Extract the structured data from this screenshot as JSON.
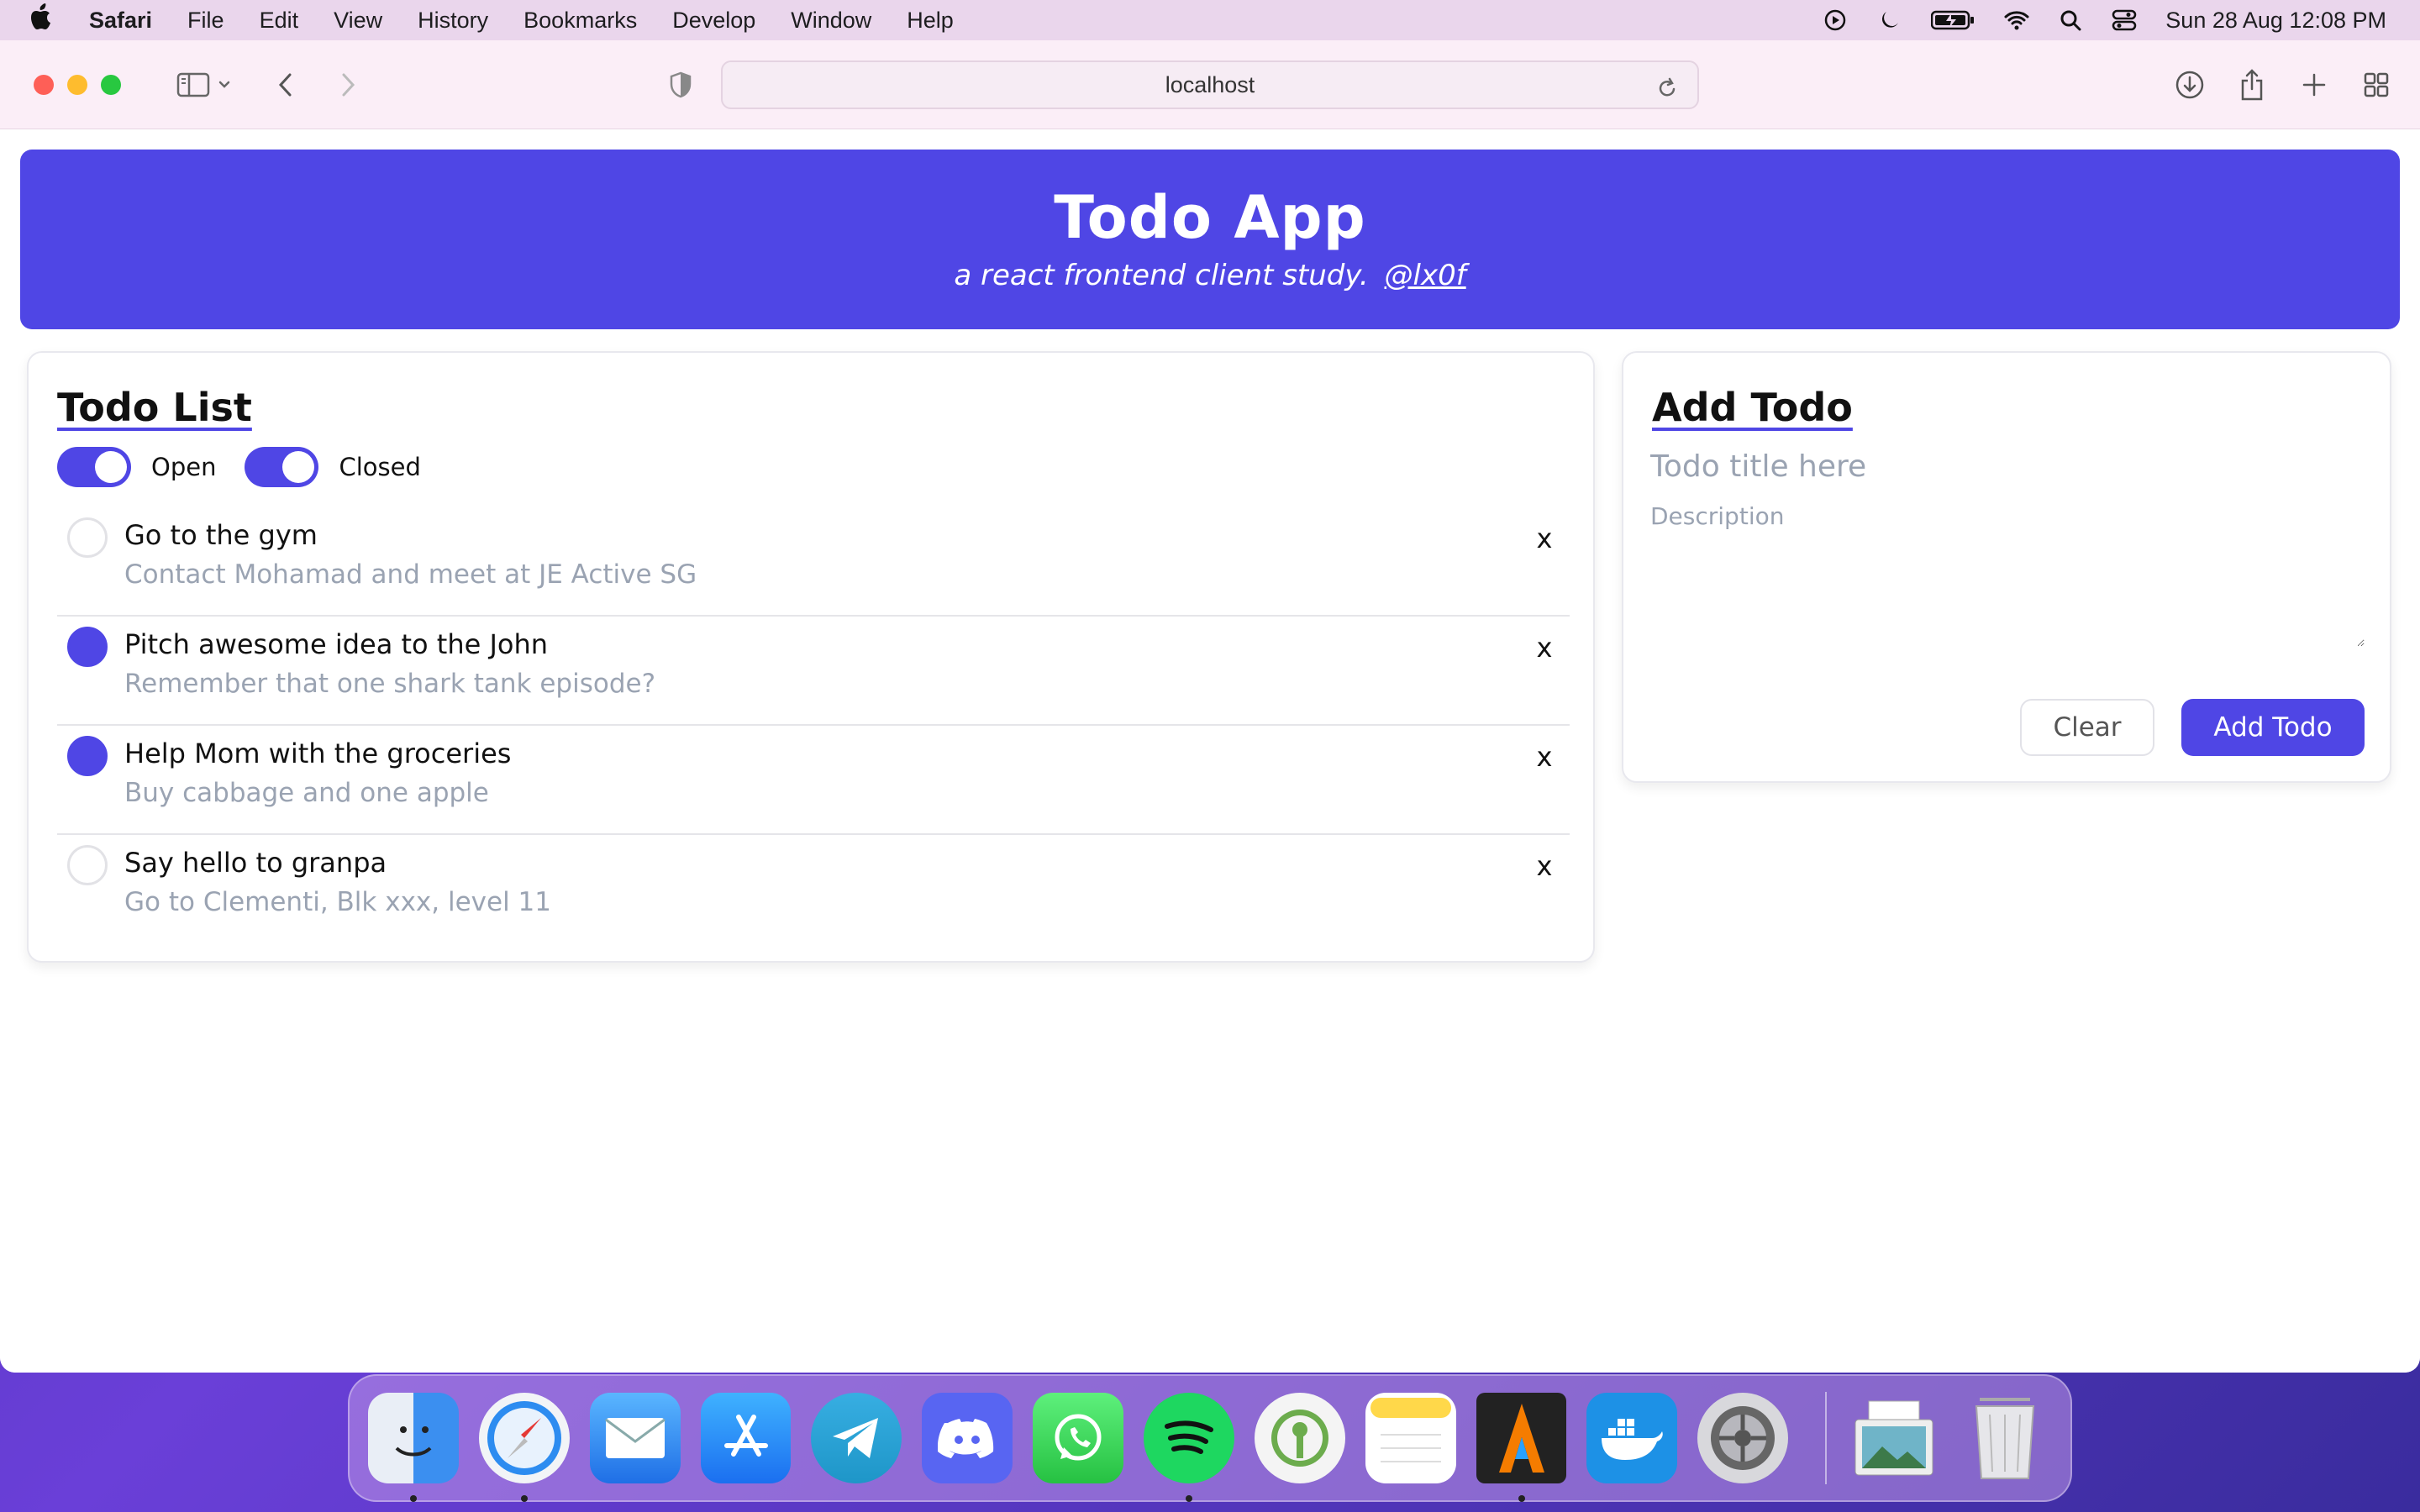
{
  "menubar": {
    "app_name": "Safari",
    "items": [
      "File",
      "Edit",
      "View",
      "History",
      "Bookmarks",
      "Develop",
      "Window",
      "Help"
    ],
    "clock": "Sun 28 Aug  12:08 PM"
  },
  "browser": {
    "url": "localhost"
  },
  "header": {
    "title": "Todo App",
    "subtitle": "a react frontend client study.",
    "author_link": "@lx0f"
  },
  "todo_list": {
    "heading": "Todo List",
    "filters": [
      {
        "label": "Open",
        "enabled": true
      },
      {
        "label": "Closed",
        "enabled": true
      }
    ],
    "delete_label": "x",
    "items": [
      {
        "title": "Go to the gym",
        "description": "Contact Mohamad and meet at JE Active SG",
        "done": false
      },
      {
        "title": "Pitch awesome idea to the John",
        "description": "Remember that one shark tank episode?",
        "done": true
      },
      {
        "title": "Help Mom with the groceries",
        "description": "Buy cabbage and one apple",
        "done": true
      },
      {
        "title": "Say hello to granpa",
        "description": "Go to Clementi, Blk xxx, level 11",
        "done": false
      }
    ]
  },
  "add_todo": {
    "heading": "Add Todo",
    "title_placeholder": "Todo title here",
    "description_placeholder": "Description",
    "clear_label": "Clear",
    "submit_label": "Add Todo"
  },
  "colors": {
    "accent": "#4f46e5",
    "muted_text": "#9aa3b2"
  },
  "dock": {
    "apps": [
      "finder",
      "safari",
      "mail",
      "app-store",
      "telegram",
      "discord",
      "whatsapp",
      "spotify",
      "keepassxc",
      "notes",
      "alacritty",
      "docker",
      "system-preferences",
      "preview",
      "trash"
    ]
  }
}
